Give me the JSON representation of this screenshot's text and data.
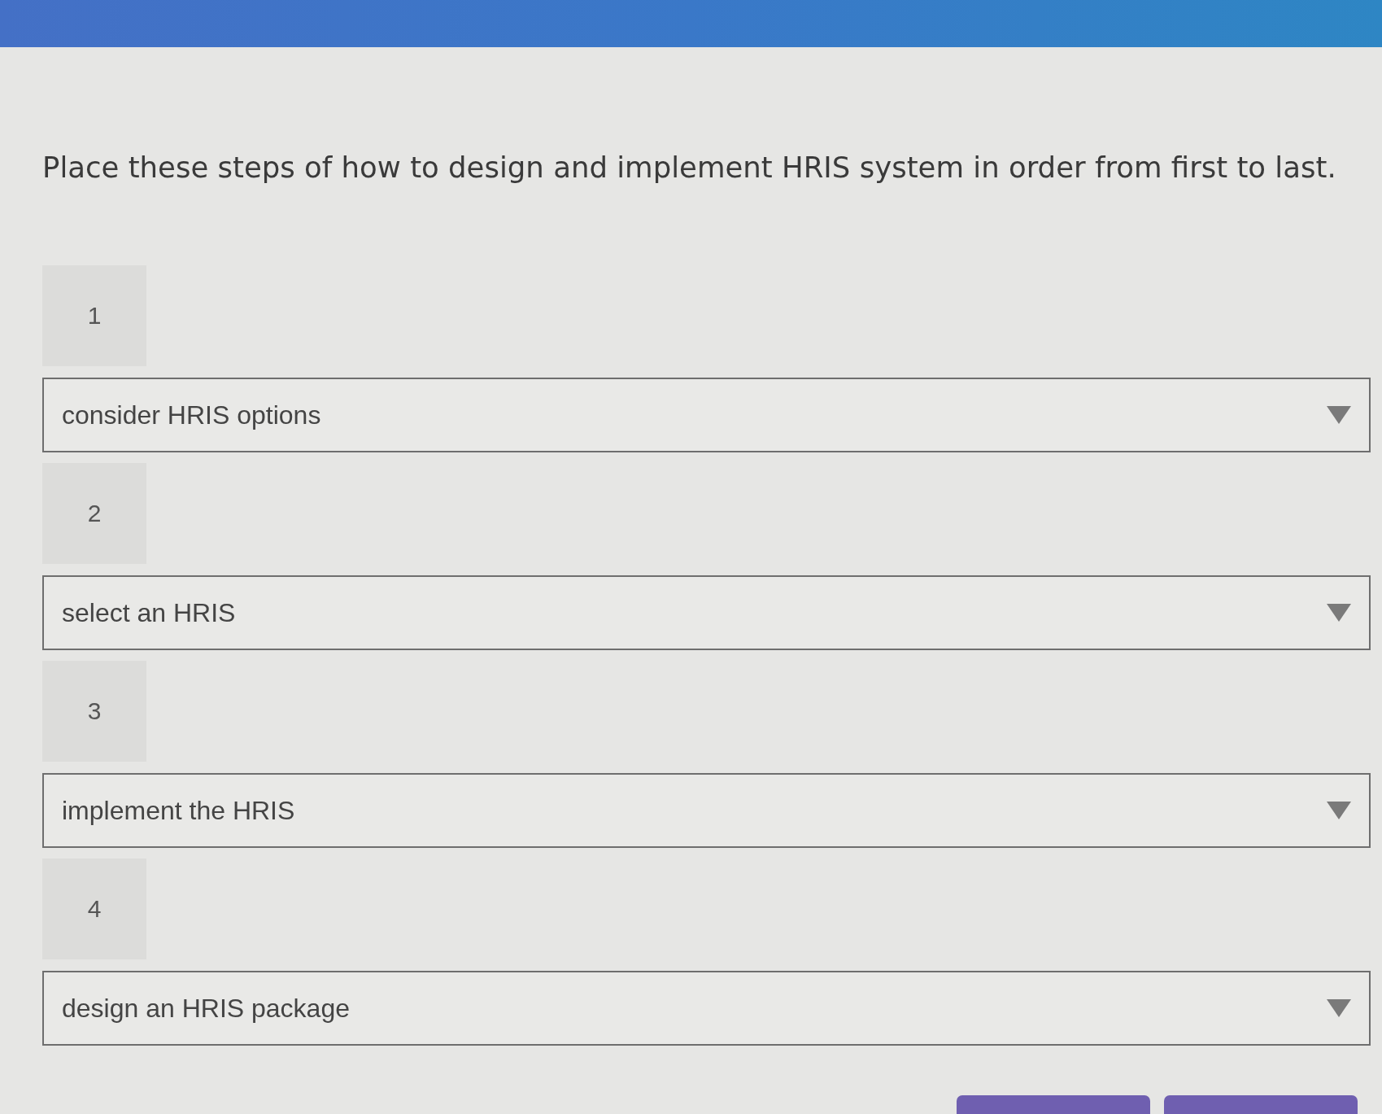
{
  "prompt": "Place these steps of how to design and implement HRIS system in order from first to last.",
  "steps": [
    {
      "number": "1",
      "value": "consider HRIS options"
    },
    {
      "number": "2",
      "value": "select an HRIS"
    },
    {
      "number": "3",
      "value": "implement the HRIS"
    },
    {
      "number": "4",
      "value": "design an HRIS package"
    }
  ],
  "buttons": [
    {
      "kind": "filled"
    },
    {
      "kind": "filled"
    }
  ]
}
